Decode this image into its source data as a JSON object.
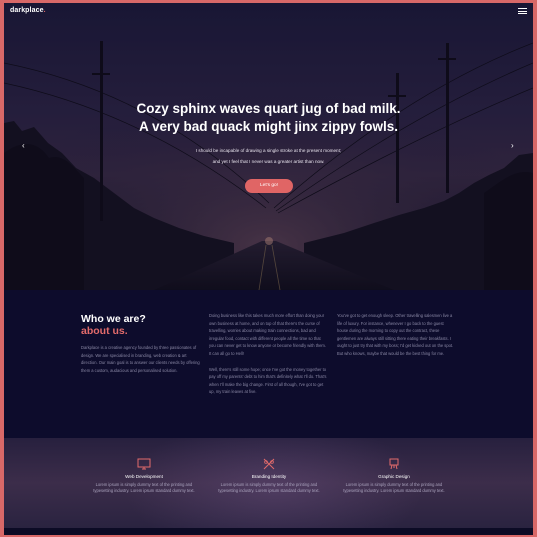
{
  "nav": {
    "brand": "darkplace",
    "brand_dot": "."
  },
  "hero": {
    "headline_1": "Cozy sphinx waves quart jug of bad milk.",
    "headline_2": "A very bad quack might jinx zippy fowls.",
    "sub_1": "I should be incapable of drawing a single stroke at the present moment;",
    "sub_2": "and yet I feel that I never was a greater artist than now.",
    "cta": "Let's go!",
    "prev": "‹",
    "next": "›"
  },
  "about": {
    "title": "Who we are?",
    "subtitle": "about us.",
    "intro": "Darkplace is a creative agency founded by three passionates of design. We are specialised in branding, web creation & art direction. Our main goal is to answer our clients needs by offering them a custom, audacious and personalised solution.",
    "col2_p1": "Doing business like this takes much more effort than doing your own business at home, and on top of that there's the curse of travelling, worries about making train connections, bad and irregular food, contact with different people all the time so that you can never get to know anyone or become friendly with them. It can all go to Hell!",
    "col2_p2": "Well, there's still some hope; once I've got the money together to pay off my parents' debt to him that's definitely what I'll do. That's when I'll make the big change. First of all though, I've got to get up, my train leaves at five.",
    "col3_p1": "You've got to get enough sleep. Other travelling salesmen live a life of luxury. For instance, whenever I go back to the guest house during the morning to copy out the contract, these gentlemen are always still sitting there eating their breakfasts. I ought to just try that with my boss; I'd get kicked out on the spot. But who knows, maybe that would be the best thing for me."
  },
  "services": [
    {
      "icon": "monitor-icon",
      "title": "Web Development",
      "desc": "Lorem ipsum is simply dummy text of the printing and typesetting industry. Lorem ipsum standard dummy text."
    },
    {
      "icon": "design-tools-icon",
      "title": "Branding Identity",
      "desc": "Lorem ipsum is simply dummy text of the printing and typesetting industry. Lorem ipsum standard dummy text."
    },
    {
      "icon": "easel-icon",
      "title": "Graphic Design",
      "desc": "Lorem ipsum is simply dummy text of the printing and typesetting industry. Lorem ipsum standard dummy text."
    }
  ],
  "colors": {
    "accent": "#e26b6b",
    "dark_bg": "#0d0c2c",
    "frame": "#d86868"
  }
}
